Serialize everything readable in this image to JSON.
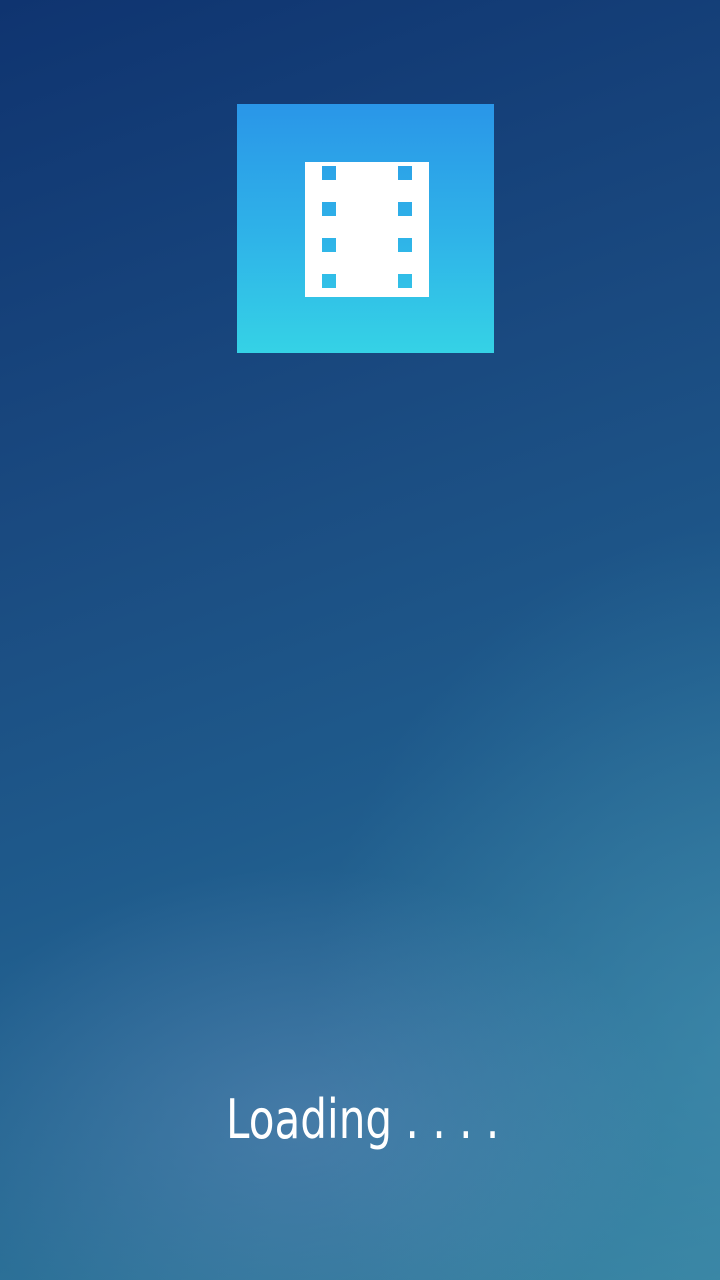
{
  "splash": {
    "logo_icon": "film-strip-icon",
    "loading_text": "Loading . . . ."
  },
  "colors": {
    "background_start": "#0f3470",
    "background_end": "#35809f",
    "logo_top": "#2a96e8",
    "logo_bottom": "#35d2e6",
    "text": "#ffffff"
  }
}
